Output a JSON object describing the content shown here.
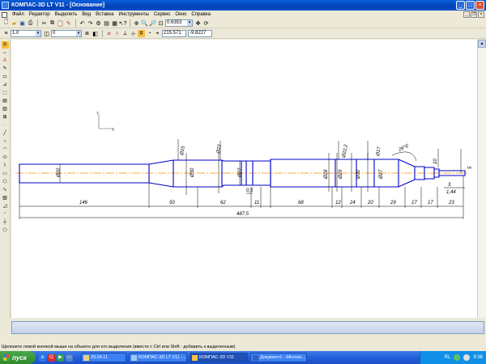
{
  "window": {
    "title": "КОМПАС-3D LT V11 - [Основание]",
    "buttons": {
      "minimize": "_",
      "maximize": "□",
      "close": "×"
    }
  },
  "menu": [
    "Файл",
    "Редактор",
    "Выделить",
    "Вид",
    "Вставка",
    "Инструменты",
    "Сервис",
    "Окно",
    "Справка"
  ],
  "toolbar": {
    "zoom_value": "0.6353",
    "style_value": "1.0",
    "layer_value": "0",
    "coord_x": "215.571",
    "coord_y": "-9.8227"
  },
  "drawing": {
    "axis_labels": {
      "x": "X",
      "y": "Y"
    },
    "diameters": [
      "Ø20",
      "Ø30",
      "Ø27",
      "Ø28",
      "Ø29",
      "Ø30",
      "Ø27"
    ],
    "upper_dims": [
      "Ø15",
      "Ø22",
      "Ø22,2",
      "Ø17"
    ],
    "angle_label": "29°6'",
    "side_dims": {
      "d10": "10",
      "d5": "5",
      "d3": "3",
      "d144": "1,44"
    },
    "horizontal_dims": [
      "146",
      "50",
      "62",
      "11",
      "68",
      "12",
      "24",
      "20",
      "29",
      "17",
      "17",
      "23"
    ],
    "small_dim": "0,5",
    "total_length": "487,5"
  },
  "status_text": "Щелкните левой кнопкой мыши на объекте для его выделения (вместе с Ctrl или Shift - добавить к выделенным)",
  "taskbar": {
    "start_label": "пуск",
    "tasks": [
      {
        "label": "29.04.11",
        "active": false
      },
      {
        "label": "КОМПАС-3D LT V11 -...",
        "active": false
      },
      {
        "label": "КОМПАС-3D V11",
        "active": true
      },
      {
        "label": "Документ1 - Microso...",
        "active": false
      }
    ],
    "lang": "RL",
    "time": "9:36"
  },
  "colors": {
    "contour": "#0000c8",
    "axis": "#ff8a00",
    "titlebar": "#0a4fc8"
  }
}
